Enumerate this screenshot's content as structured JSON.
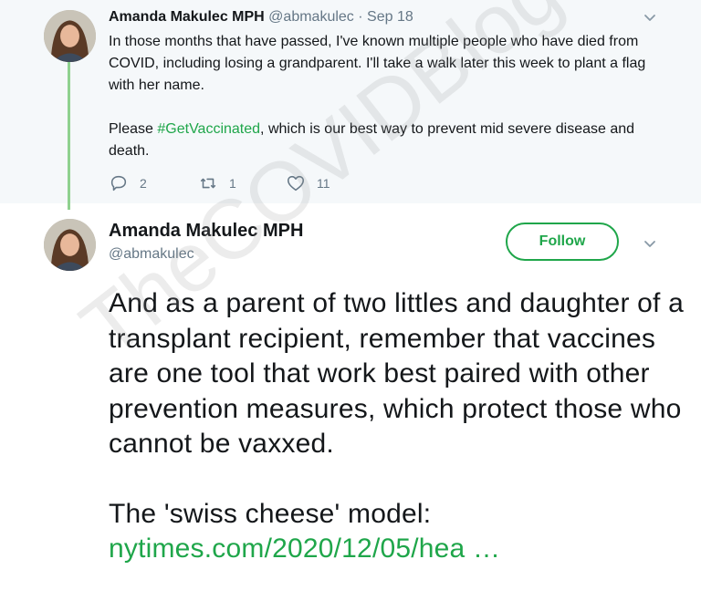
{
  "previous_tweet": {
    "name": "Amanda Makulec MPH",
    "handle": "@abmakulec",
    "separator": "·",
    "date": "Sep 18",
    "text_line1": "In those months that have passed, I've known multiple people who have died from COVID, including losing a grandparent. I'll take a walk later this week to plant a flag with her name.",
    "text_p2_before": "Please ",
    "hashtag": "#GetVaccinated",
    "text_p2_after": ", which is our best way to prevent mid severe disease and death.",
    "reply_count": "2",
    "retweet_count": "1",
    "like_count": "11"
  },
  "main_tweet": {
    "name": "Amanda Makulec MPH",
    "handle": "@abmakulec",
    "follow_label": "Follow",
    "text_p1": "And as a parent of two littles and daughter of a transplant recipient, remember that vaccines are one tool that work best paired with other prevention measures, which protect those who cannot be vaxxed.",
    "text_p2": "The 'swiss cheese' model:",
    "link": "nytimes.com/2020/12/05/hea …"
  },
  "watermark": "TheCOVIDBlog.com",
  "colors": {
    "accent": "#1fa64a",
    "thread_line": "#8fd18f",
    "muted": "#657786"
  },
  "icons": [
    "chevron-down-icon",
    "reply-icon",
    "retweet-icon",
    "heart-icon"
  ]
}
